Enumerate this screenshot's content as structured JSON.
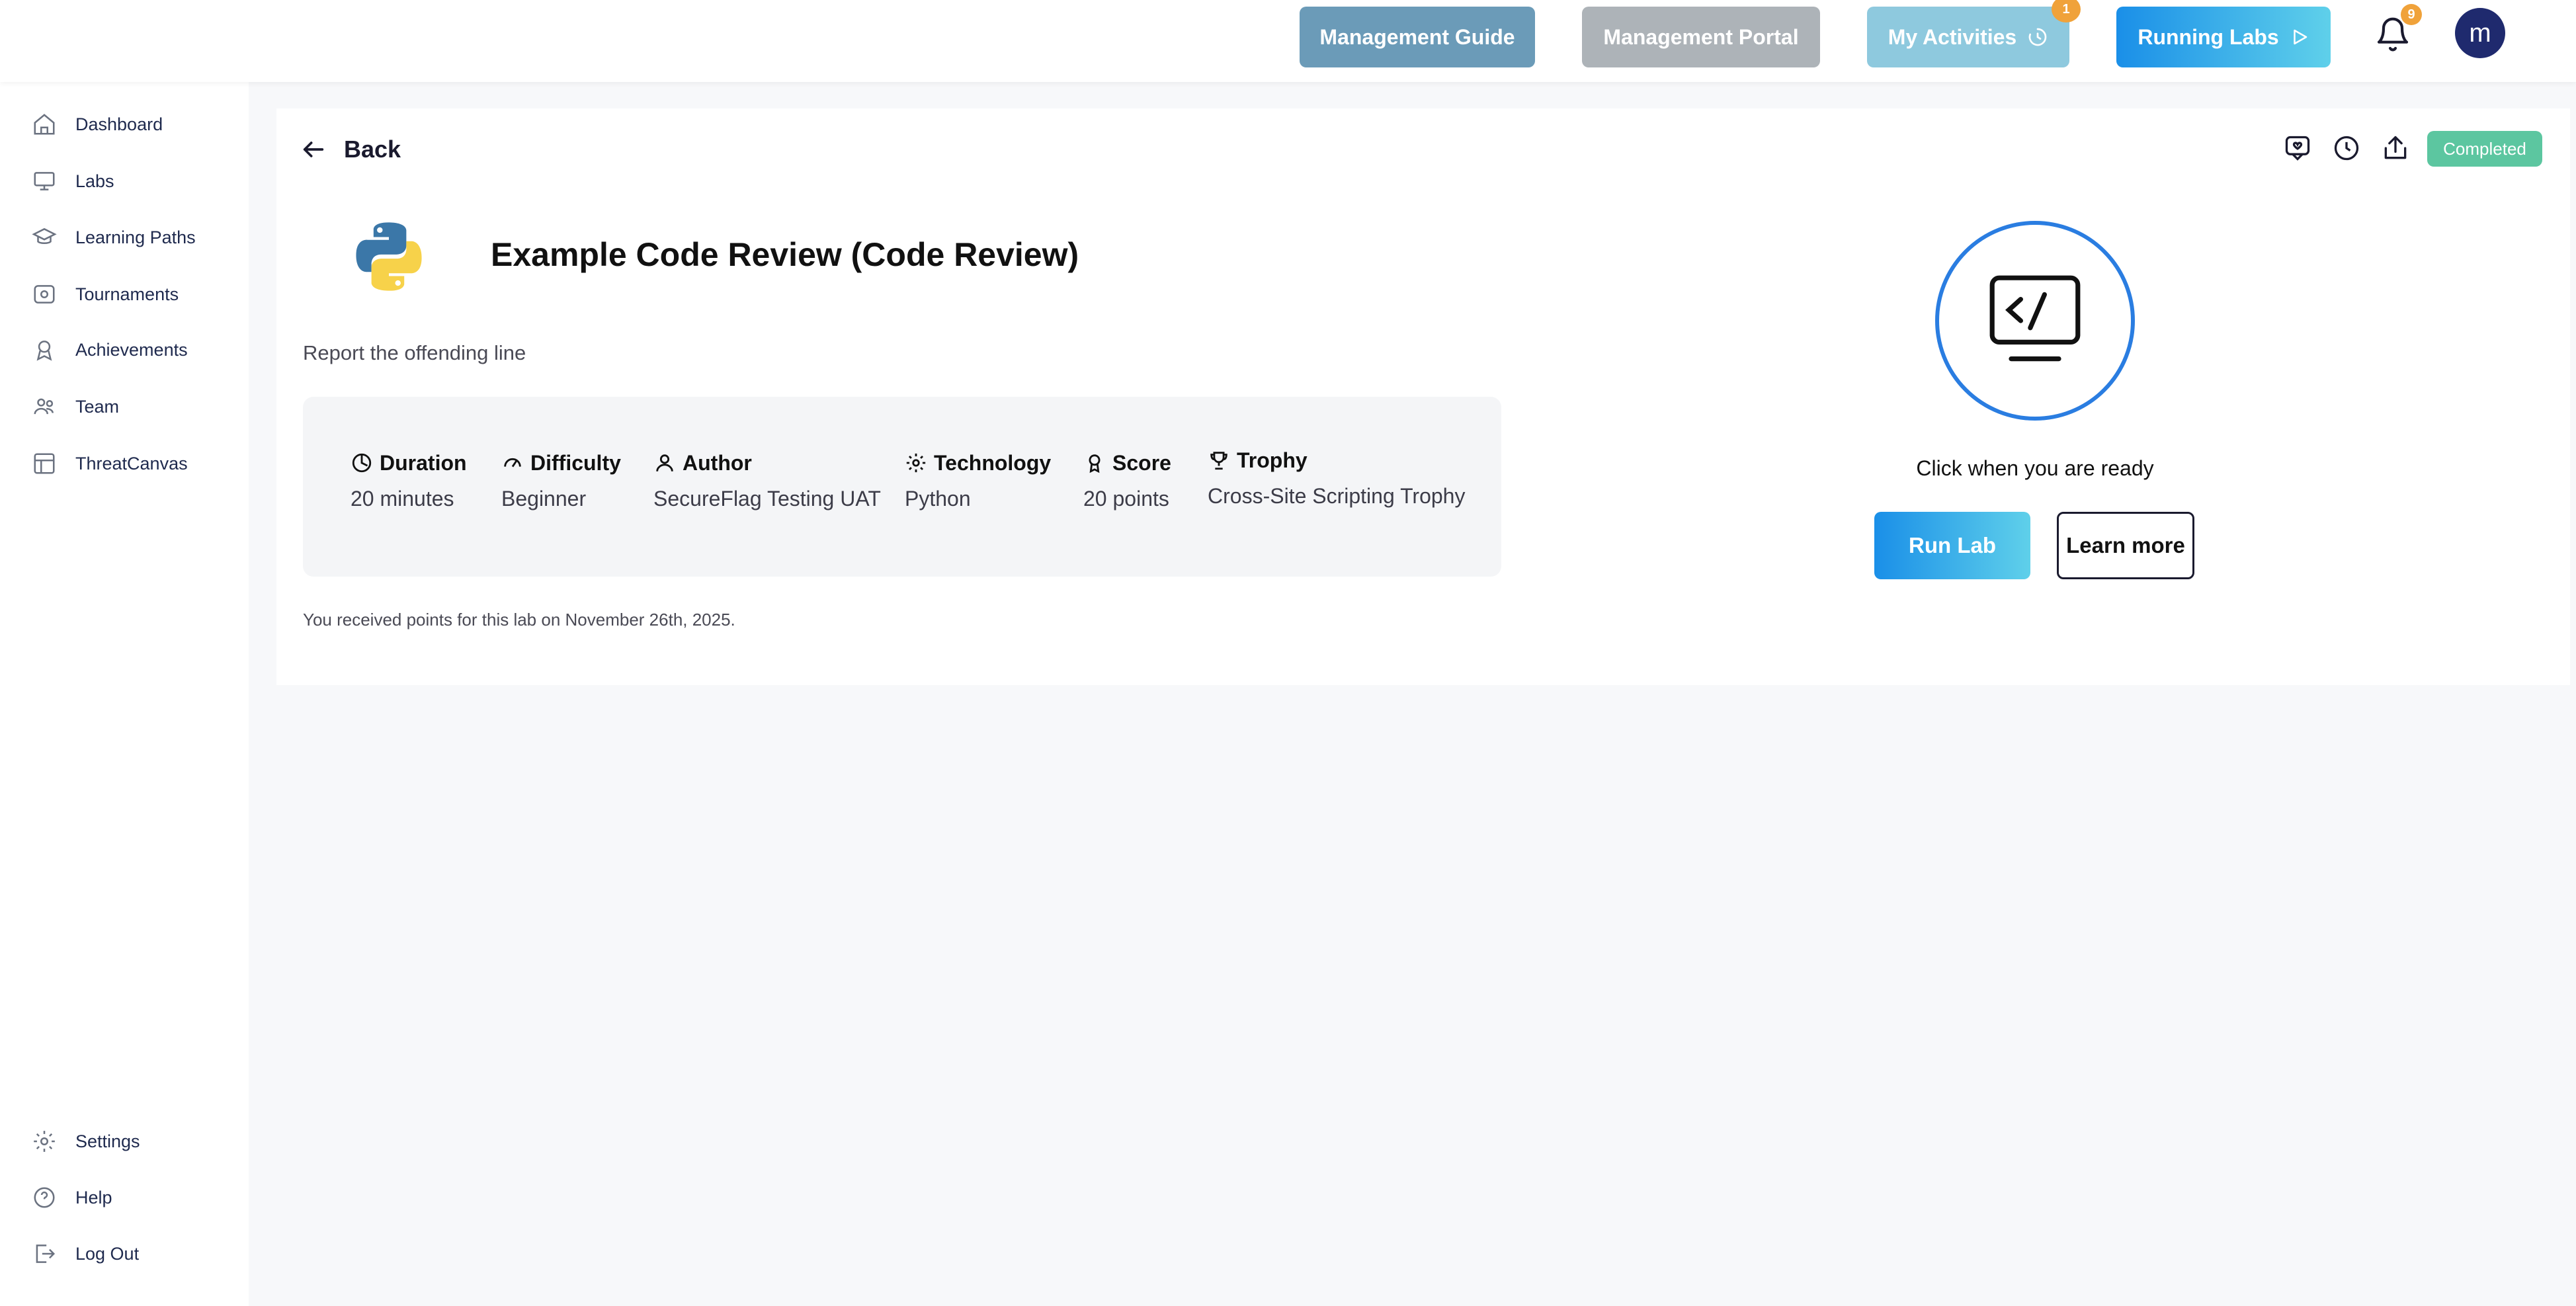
{
  "topbar": {
    "management_guide": "Management Guide",
    "management_portal": "Management Portal",
    "my_activities": "My Activities",
    "my_activities_badge": "1",
    "running_labs": "Running Labs",
    "notifications_badge": "9",
    "avatar_initial": "m"
  },
  "sidebar": {
    "items": [
      {
        "label": "Dashboard",
        "icon": "home-icon"
      },
      {
        "label": "Labs",
        "icon": "monitor-icon"
      },
      {
        "label": "Learning Paths",
        "icon": "graduation-cap-icon"
      },
      {
        "label": "Tournaments",
        "icon": "tournament-icon"
      },
      {
        "label": "Achievements",
        "icon": "award-icon"
      },
      {
        "label": "Team",
        "icon": "team-icon"
      },
      {
        "label": "ThreatCanvas",
        "icon": "canvas-icon"
      }
    ],
    "bottom_items": [
      {
        "label": "Settings",
        "icon": "gear-icon"
      },
      {
        "label": "Help",
        "icon": "help-icon"
      },
      {
        "label": "Log Out",
        "icon": "logout-icon"
      }
    ]
  },
  "main": {
    "back_label": "Back",
    "title": "Example Code Review (Code Review)",
    "description": "Report the offending line",
    "info": {
      "duration": {
        "label": "Duration",
        "value": "20 minutes"
      },
      "difficulty": {
        "label": "Difficulty",
        "value": "Beginner"
      },
      "author": {
        "label": "Author",
        "value": "SecureFlag Testing UAT"
      },
      "technology": {
        "label": "Technology",
        "value": "Python"
      },
      "score": {
        "label": "Score",
        "value": "20 points"
      },
      "trophy": {
        "label": "Trophy",
        "value": "Cross-Site Scripting Trophy"
      }
    },
    "received_text": "You received points for this lab on November 26th, 2025.",
    "status_badge": "Completed",
    "ready_text": "Click when you are ready",
    "run_lab": "Run Lab",
    "learn_more": "Learn more"
  },
  "colors": {
    "accent": "#1a8fe8",
    "completed": "#5cc6a0",
    "badge": "#f0a23a",
    "avatar": "#1f2a6e"
  }
}
